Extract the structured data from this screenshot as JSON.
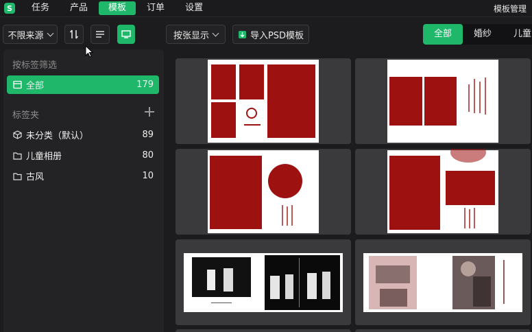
{
  "nav": {
    "logo_letter": "S",
    "items": [
      {
        "label": "任务",
        "active": false
      },
      {
        "label": "产品",
        "active": false
      },
      {
        "label": "模板",
        "active": true
      },
      {
        "label": "订单",
        "active": false
      },
      {
        "label": "设置",
        "active": false
      }
    ],
    "right_link": "模板管理"
  },
  "toolbar": {
    "source_filter": "不限来源",
    "display_mode": "按张显示",
    "import_label": "导入PSD模板",
    "categories": [
      {
        "label": "全部",
        "active": true
      },
      {
        "label": "婚纱",
        "active": false
      },
      {
        "label": "儿童",
        "active": false
      }
    ]
  },
  "sidebar": {
    "filter_title": "按标签筛选",
    "all": {
      "label": "全部",
      "count": "179"
    },
    "folders_title": "标签夹",
    "folders": [
      {
        "label": "未分类（默认）",
        "count": "89",
        "icon": "cube-icon"
      },
      {
        "label": "儿童相册",
        "count": "80",
        "icon": "folder-icon"
      },
      {
        "label": "古风",
        "count": "10",
        "icon": "folder-icon"
      }
    ]
  },
  "colors": {
    "accent": "#1fb86a",
    "template_red": "#9e1111"
  }
}
